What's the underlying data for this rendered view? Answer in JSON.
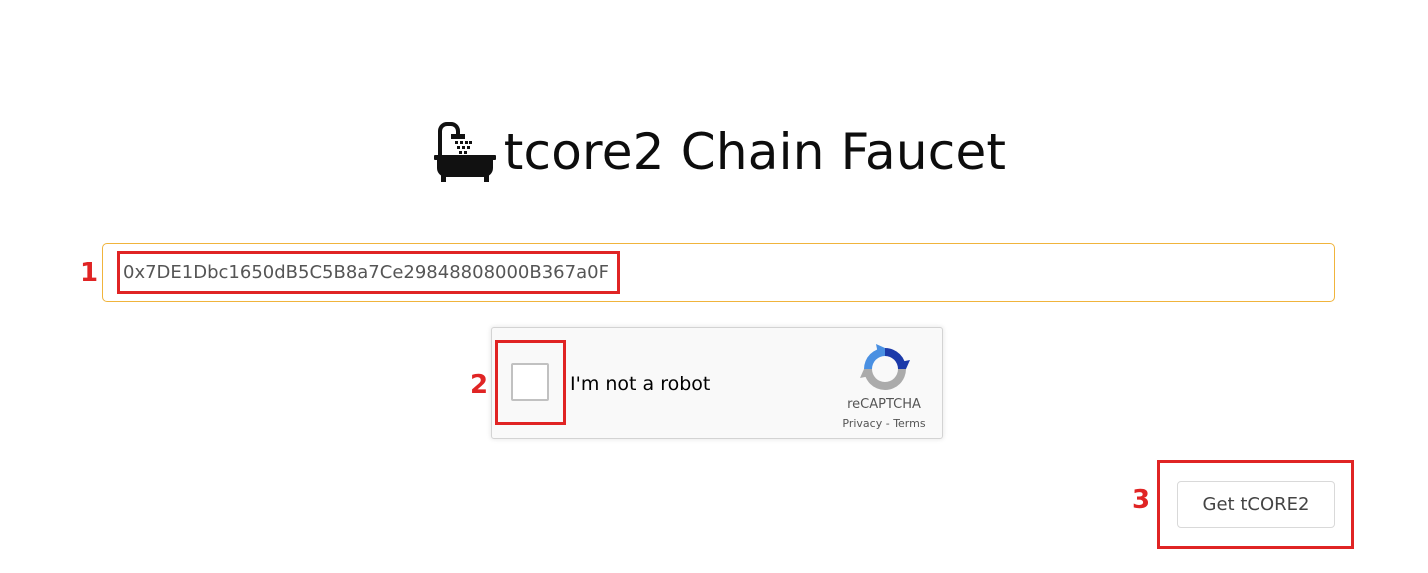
{
  "header": {
    "title": "tcore2 Chain Faucet",
    "icon": "bathtub-shower-icon"
  },
  "form": {
    "address_value": "0x7DE1Dbc1650dB5C5B8a7Ce29848808000B367a0F",
    "submit_label": "Get tCORE2"
  },
  "captcha": {
    "label": "I'm not a robot",
    "brand": "reCAPTCHA",
    "privacy": "Privacy",
    "separator": " - ",
    "terms": "Terms",
    "checked": false,
    "icon": "recaptcha-logo-icon"
  },
  "annotations": [
    {
      "number": "1",
      "target": "address-input"
    },
    {
      "number": "2",
      "target": "captcha-checkbox"
    },
    {
      "number": "3",
      "target": "get-tcore2-button"
    }
  ],
  "colors": {
    "input_border": "#f0b43c",
    "annotation": "#e02424"
  }
}
